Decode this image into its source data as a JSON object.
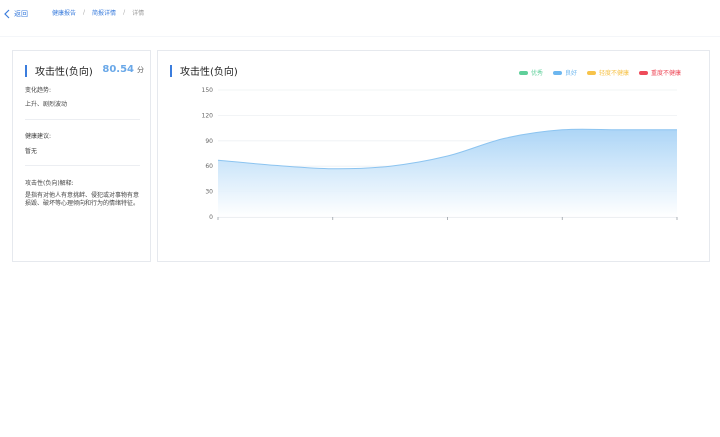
{
  "nav": {
    "back_label": "返回",
    "breadcrumb": [
      "健康报告",
      "简报详情",
      "详情"
    ],
    "separator": "/"
  },
  "detail": {
    "title": "攻击性(负向)",
    "score": "80.54",
    "score_unit": "分",
    "trend_label": "变化趋势:",
    "trend_value": "上升、剧烈波动",
    "advice_label": "健康建议:",
    "advice_value": "暂无",
    "explain_label": "攻击性(负向)解释:",
    "explain_text": "是指有对他人有意挑衅、侵犯或对事物有意损毁、破坏等心理倾向和行为的情绪特征。"
  },
  "chart_panel": {
    "title": "攻击性(负向)"
  },
  "chart_data": {
    "type": "area",
    "title": "",
    "xlabel": "",
    "ylabel": "",
    "ylim": [
      0,
      150
    ],
    "yticks": [
      "0",
      "30",
      "60",
      "90",
      "120",
      "150"
    ],
    "x": [
      0,
      0.5,
      1,
      1.5,
      2,
      2.5,
      3,
      3.5,
      4
    ],
    "values": [
      67,
      61,
      57,
      60,
      72,
      93,
      103,
      103,
      103
    ],
    "x_tick_count": 5,
    "grid": true,
    "legend_position": "top-right",
    "legend": [
      {
        "name": "优秀",
        "color": "#5fcf9a"
      },
      {
        "name": "良好",
        "color": "#6cb6ef"
      },
      {
        "name": "轻度不健康",
        "color": "#f7c34a"
      },
      {
        "name": "重度不健康",
        "color": "#ee4b5a"
      }
    ],
    "line_color": "#8cc4f0",
    "fill_color_top": "#a8d3f6",
    "fill_color_bottom": "#ffffff"
  }
}
